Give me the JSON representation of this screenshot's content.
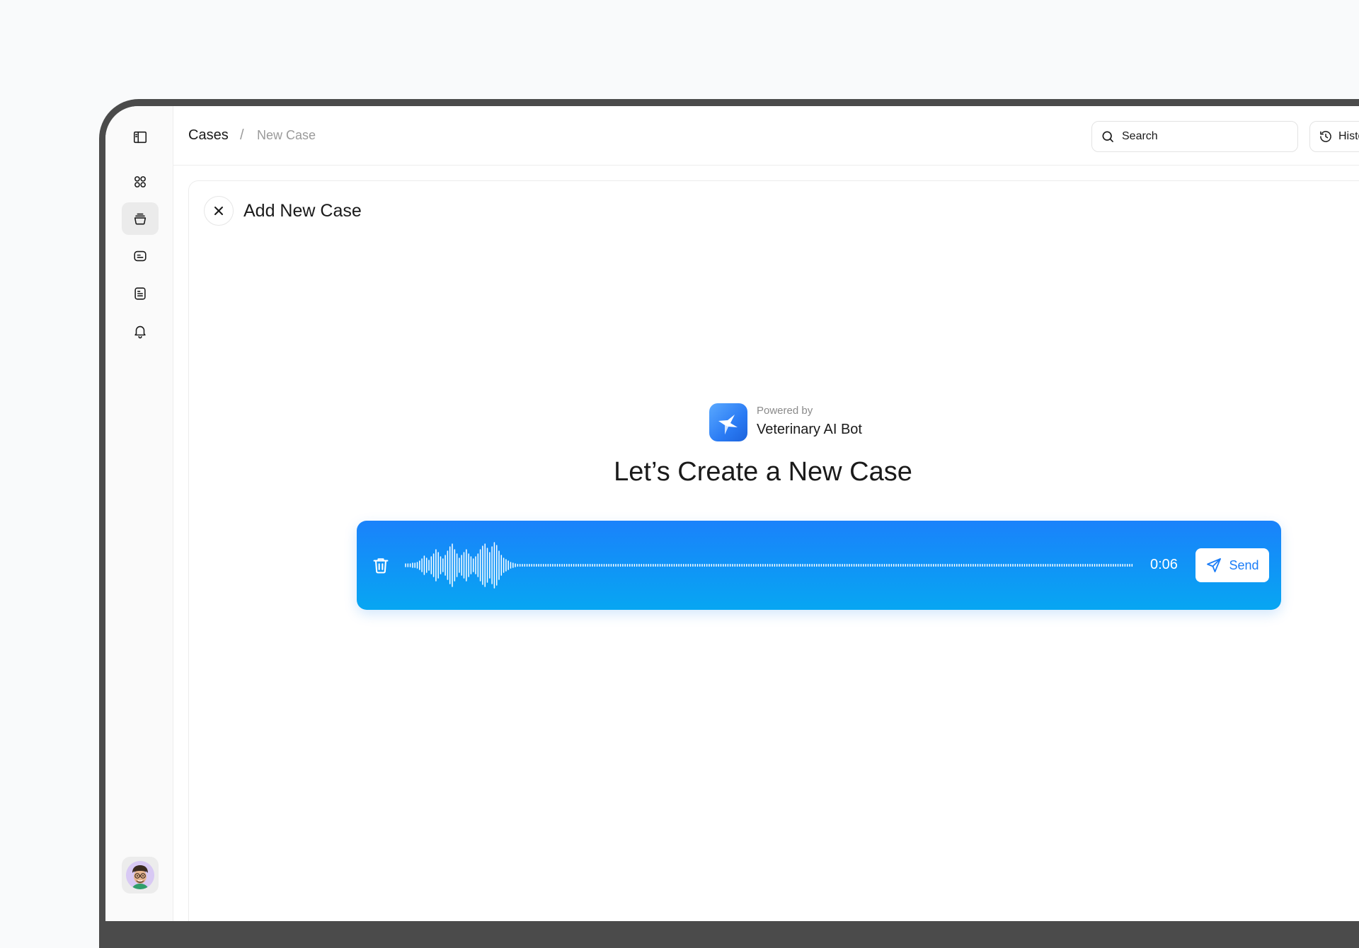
{
  "breadcrumb": {
    "root": "Cases",
    "separator": "/",
    "current": "New Case"
  },
  "header": {
    "search_label": "Search",
    "history_label": "History"
  },
  "sidebar": {
    "items": [
      {
        "icon": "panel-toggle-icon"
      },
      {
        "icon": "grid-icon"
      },
      {
        "icon": "pet-bowl-icon",
        "active": true
      },
      {
        "icon": "chat-icon"
      },
      {
        "icon": "document-icon"
      },
      {
        "icon": "bell-icon"
      }
    ],
    "avatar": "user-avatar"
  },
  "card": {
    "title": "Add New Case",
    "powered_by_label": "Powered by",
    "powered_by_name": "Veterinary AI Bot",
    "headline": "Let’s Create a New Case"
  },
  "recorder": {
    "duration": "0:06",
    "send_label": "Send",
    "colors": {
      "gradient_top": "#1a82fb",
      "gradient_bottom": "#07a6f2",
      "accent": "#1b7df7"
    }
  }
}
